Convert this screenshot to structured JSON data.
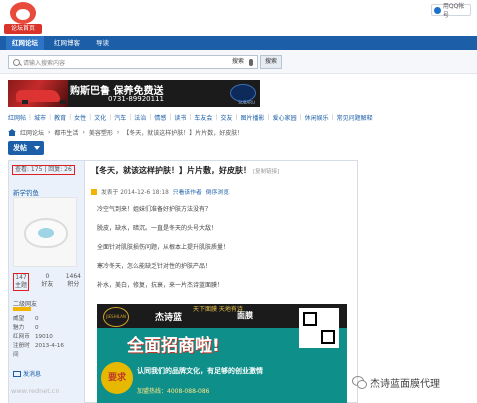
{
  "header": {
    "logo_text": "论坛首页",
    "login_label": "用QQ帐号"
  },
  "nav": {
    "tabs": [
      "红网论坛",
      "红网博客",
      "导读"
    ]
  },
  "search": {
    "placeholder": "请输入搜索内容",
    "scope": "搜索",
    "button": "搜索"
  },
  "banner": {
    "brand": "购斯巴鲁 保养免费送",
    "phone": "0731-89920111",
    "logo_text": "SUBARU"
  },
  "categories": [
    "红网帖",
    "城市",
    "教育",
    "女性",
    "文化",
    "汽车",
    "法治",
    "情感",
    "读书",
    "车友会",
    "交友",
    "图片播影",
    "爱心家园",
    "休闲娱乐",
    "常见问题解释"
  ],
  "breadcrumb": {
    "items": [
      "红网论坛",
      "都市生活",
      "美容塑形",
      "【冬天，就该这样护肤！】片片数，好皮肤！"
    ]
  },
  "post_button": "发帖",
  "sidebar": {
    "stats_line": "查看: 175 | 回复: 26",
    "author": "新学钓鱼",
    "user_stats": [
      {
        "value": "147",
        "label": "主题"
      },
      {
        "value": "0",
        "label": "好友"
      },
      {
        "value": "1464",
        "label": "积分"
      }
    ],
    "level": "二级网友",
    "info": [
      {
        "k": "威望",
        "v": "0"
      },
      {
        "k": "魅力",
        "v": "0"
      },
      {
        "k": "红网币",
        "v": "19010"
      },
      {
        "k": "注册时间",
        "v": "2013-4-16"
      }
    ],
    "send_msg": "发消息",
    "watermark": "www.rednet.cn"
  },
  "post": {
    "title": "【冬天，就该这样护肤！】片片敷，好皮肤！",
    "copy_link": "[复制链接]",
    "meta_posted": "发表于 2014-12-6 18:18",
    "meta_author_only": "只看该作者",
    "meta_order": "倒序浏览",
    "paragraphs": [
      "冷空气到来！姐妹们准备好护肤方法没有？",
      "脱皮，缺水，暗沉。一直是冬天的头号大敌！",
      "全面针对肌肤损伤问题，从根本上提升肌肤质量！",
      "寒冷冬天，怎么能缺乏针对性的护肤产品！",
      "补水，美白，修复，抗衰，来一片杰诗蓝面膜！"
    ]
  },
  "ad": {
    "brand": "JIESHILAN",
    "name": "杰诗蓝",
    "sub": "天下面膜 天地有诗",
    "face": "面膜",
    "big": "全面招商啦!",
    "badge": "要求",
    "slogan": "认同我们的品牌文化，有足够的创业激情",
    "bottom": "加盟热线：4008-088-086"
  },
  "wechat": {
    "label": "杰诗蓝面膜代理"
  }
}
